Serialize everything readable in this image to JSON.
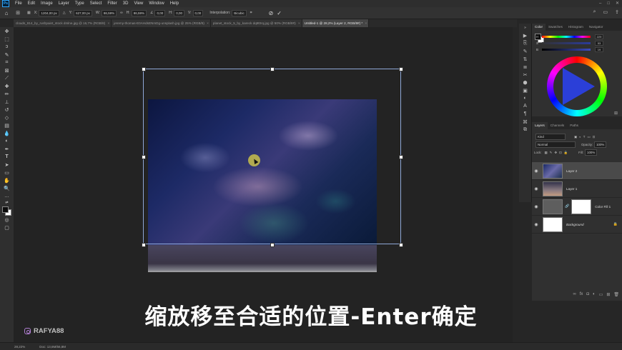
{
  "menubar": {
    "items": [
      "File",
      "Edit",
      "Image",
      "Layer",
      "Type",
      "Select",
      "Filter",
      "3D",
      "View",
      "Window",
      "Help"
    ]
  },
  "optionsbar": {
    "x_label": "X:",
    "x_value": "1204,00 px",
    "y_label": "Y:",
    "y_value": "627,00 px",
    "w_label": "W:",
    "w_value": "86,59%",
    "h_label": "H:",
    "h_value": "86,59%",
    "angle_value": "0,00",
    "hskew_label": "H:",
    "hskew_value": "0,00",
    "vskew_label": "V:",
    "vskew_value": "0,00",
    "interp_label": "Interpolation:",
    "interp_value": "Bicubic"
  },
  "tabs": [
    {
      "label": "clouds_814_by_rushpaint_stock dmlne.jpg @ 16,7% (RGB/8)"
    },
    {
      "label": "jeremy-thomas-E0AHdsENmDg-unsplash.jpg @ 25% (RGB/8)"
    },
    {
      "label": "planet_stock_5_by_kareck dq8t0rq.jpg @ 50% (RGB/8#)"
    },
    {
      "label": "Untitled-1 @ 28,2% (Layer 2, RGB/8#) *"
    }
  ],
  "colorPanel": {
    "tabs": [
      "Color",
      "Swatches",
      "Histogram",
      "Navigator"
    ],
    "sliders": [
      {
        "label": "H",
        "value": "229"
      },
      {
        "label": "S",
        "value": "53"
      },
      {
        "label": "B",
        "value": "19"
      }
    ]
  },
  "layersPanel": {
    "tabs": [
      "Layers",
      "Channels",
      "Paths"
    ],
    "kind_placeholder": "Kind",
    "blend_mode": "Normal",
    "opacity_label": "Opacity:",
    "opacity_value": "100%",
    "lock_label": "Lock:",
    "fill_label": "Fill:",
    "fill_value": "100%",
    "layers": [
      {
        "name": "Layer 2"
      },
      {
        "name": "Layer 1"
      },
      {
        "name": "Color Fill 1"
      },
      {
        "name": "Background"
      }
    ]
  },
  "statusbar": {
    "zoom": "28,22%",
    "doc": "Doc: 13,6M/56,8M"
  },
  "subtitle": "缩放移至合适的位置-Enter确定",
  "watermark": "RAFYA88"
}
